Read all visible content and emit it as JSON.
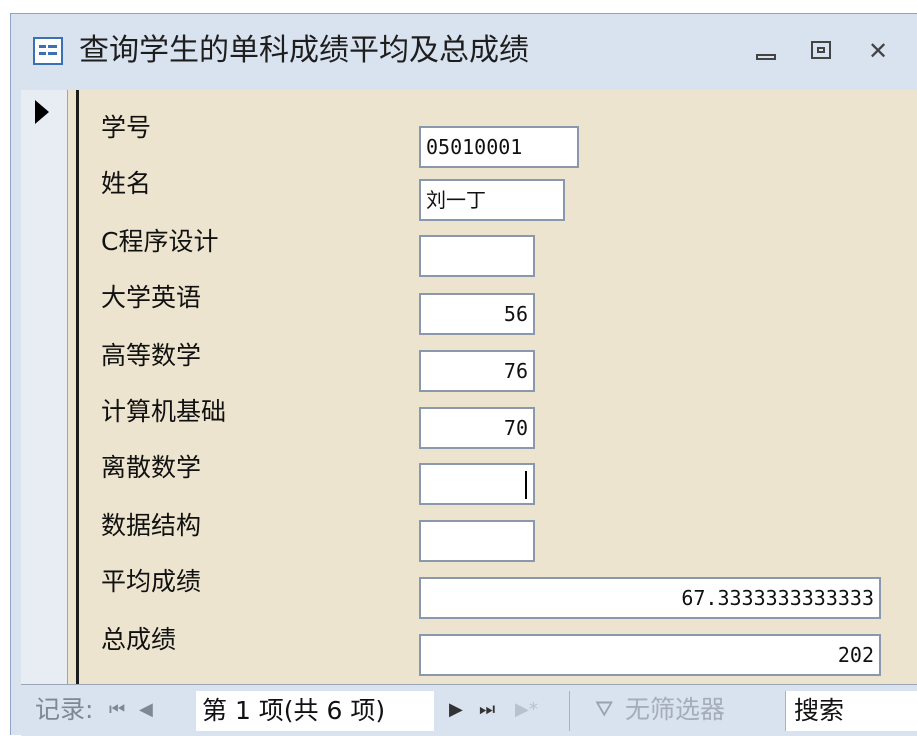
{
  "window": {
    "title": "查询学生的单科成绩平均及总成绩",
    "controls": {
      "minimize": "minimize",
      "restore": "restore",
      "close": "✕"
    }
  },
  "form": {
    "fields": [
      {
        "label": "学号",
        "value": "05010001"
      },
      {
        "label": "姓名",
        "value": "刘一丁"
      },
      {
        "label": "C程序设计",
        "value": ""
      },
      {
        "label": "大学英语",
        "value": "56"
      },
      {
        "label": "高等数学",
        "value": "76"
      },
      {
        "label": "计算机基础",
        "value": "70"
      },
      {
        "label": "离散数学",
        "value": ""
      },
      {
        "label": "数据结构",
        "value": ""
      },
      {
        "label": "平均成绩",
        "value": "67.3333333333333"
      },
      {
        "label": "总成绩",
        "value": "202"
      }
    ]
  },
  "navigation": {
    "record_label": "记录:",
    "first_icon": "⏮",
    "prev_icon": "◀",
    "position": "第 1 项(共 6 项)",
    "next_icon": "▶",
    "last_icon": "⏭",
    "new_icon": "▶*",
    "filter_icon": "funnel-icon",
    "filter_label": "无筛选器",
    "search_label": "搜索"
  }
}
